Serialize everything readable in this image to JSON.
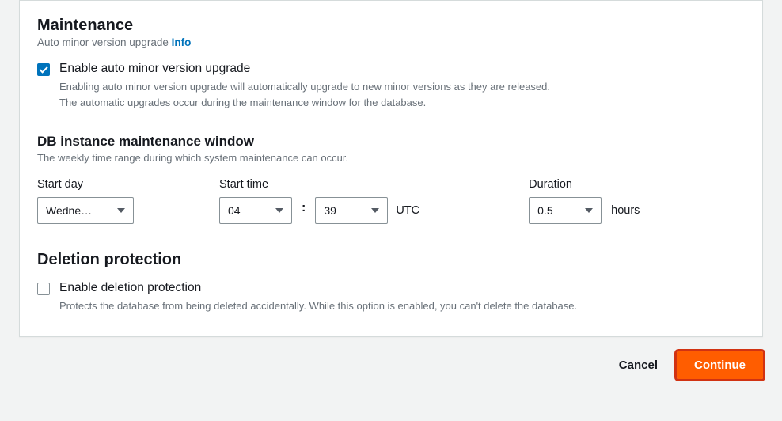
{
  "maintenance": {
    "title": "Maintenance",
    "subhead": "Auto minor version upgrade",
    "info": "Info",
    "auto_upgrade": {
      "checked": true,
      "label": "Enable auto minor version upgrade",
      "desc": "Enabling auto minor version upgrade will automatically upgrade to new minor versions as they are released. The automatic upgrades occur during the maintenance window for the database."
    },
    "window": {
      "title": "DB instance maintenance window",
      "desc": "The weekly time range during which system maintenance can occur.",
      "start_day_label": "Start day",
      "start_day_value": "Wedne…",
      "start_time_label": "Start time",
      "hour_value": "04",
      "minute_value": "39",
      "tz": "UTC",
      "duration_label": "Duration",
      "duration_value": "0.5",
      "duration_unit": "hours"
    }
  },
  "deletion": {
    "title": "Deletion protection",
    "checked": false,
    "label": "Enable deletion protection",
    "desc": "Protects the database from being deleted accidentally. While this option is enabled, you can't delete the database."
  },
  "footer": {
    "cancel": "Cancel",
    "continue": "Continue"
  }
}
